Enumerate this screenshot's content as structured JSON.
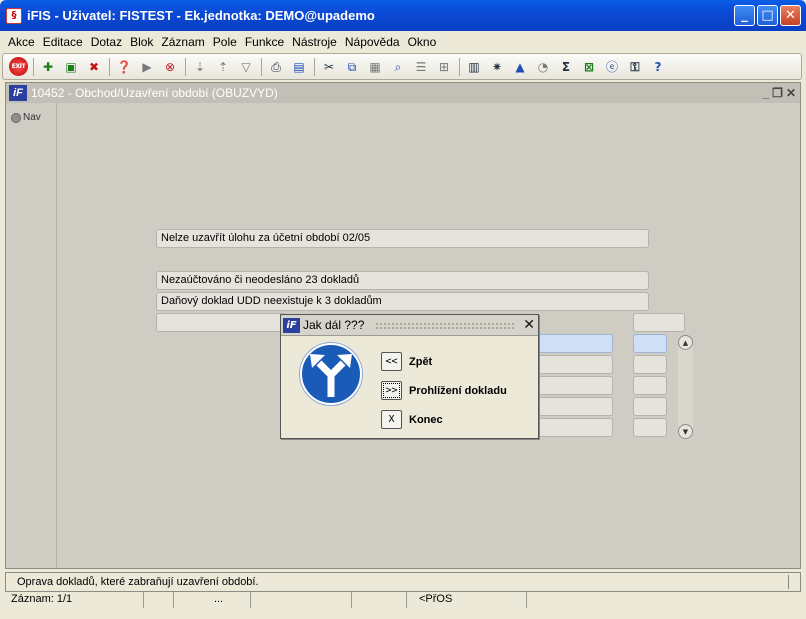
{
  "window": {
    "title": "iFIS - Uživatel: FISTEST - Ek.jednotka: DEMO@upademo",
    "minimize": "_",
    "maximize": "□",
    "close": "✕"
  },
  "menu": [
    "Akce",
    "Editace",
    "Dotaz",
    "Blok",
    "Záznam",
    "Pole",
    "Funkce",
    "Nástroje",
    "Nápověda",
    "Okno"
  ],
  "toolbar": {
    "exit_label": "EXIT",
    "icons": [
      "insert-record-icon",
      "save-icon",
      "delete-record-icon",
      "enter-query-icon",
      "execute-query-icon",
      "cancel-query-icon",
      "sort-ascending-icon",
      "sort-descending-icon",
      "filter-icon",
      "print-icon",
      "print-preview-icon",
      "cut-icon",
      "copy-icon",
      "paste-icon",
      "search-icon",
      "list-icon",
      "tree-icon",
      "calculator-icon",
      "settings-icon",
      "chart-icon",
      "clock-icon",
      "sum-icon",
      "excel-icon",
      "ie-icon",
      "help-key-icon",
      "help-icon"
    ]
  },
  "form": {
    "title": "10452 - Obchod/Uzavření období (OBUZVYD)",
    "logo": "iF",
    "nav_label": "Nav"
  },
  "messages": {
    "line1": "Nelze uzavřít úlohu za účetní období 02/05",
    "line2": "Nezaúčtováno či neodesláno 23 dokladů",
    "line3": "Daňový doklad UDD neexistuje k 3 dokladům"
  },
  "dialog": {
    "title": "Jak dál ???",
    "logo": "iF",
    "close": "✕",
    "options": [
      {
        "key": "<<",
        "label": "Zpět"
      },
      {
        "key": ">>",
        "label": "Prohlížení dokladu"
      },
      {
        "key": "X",
        "label": "Konec"
      }
    ]
  },
  "status": {
    "message": "Oprava dokladů, které zabraňují uzavření období.",
    "record": "Záznam: 1/1",
    "ellipsis": "...",
    "mode": "<PřOS"
  },
  "colors": {
    "titlebar": "#0a4ad6",
    "highlight_field": "#cfe0f6",
    "sign": "#1a5bb8"
  }
}
